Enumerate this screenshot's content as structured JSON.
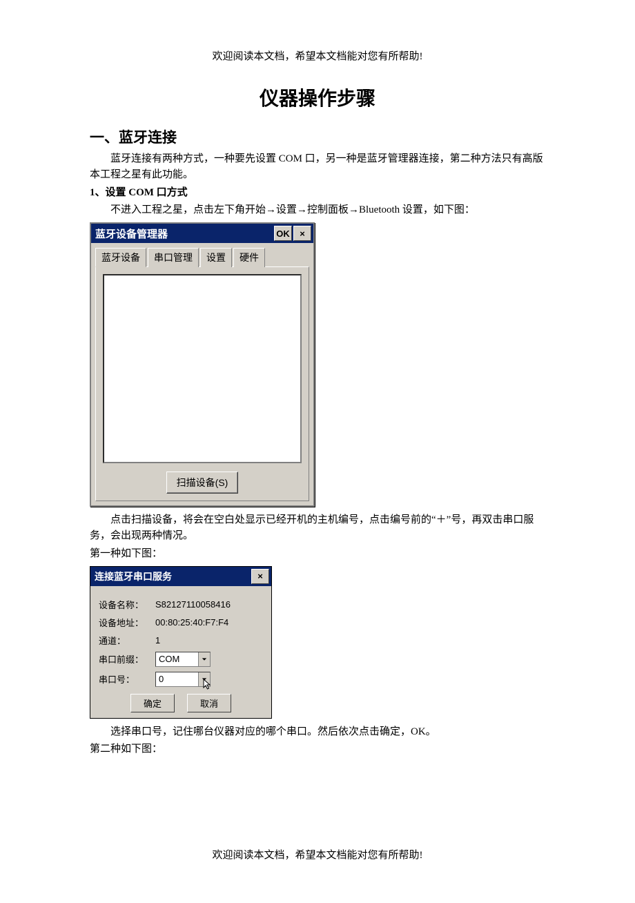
{
  "greeting": "欢迎阅读本文档，希望本文档能对您有所帮助!",
  "title": "仪器操作步骤",
  "sec1": {
    "heading": "一、蓝牙连接",
    "p1": "蓝牙连接有两种方式，一种要先设置 COM 口，另一种是蓝牙管理器连接，第二种方法只有高版本工程之星有此功能。",
    "sub1": "1、设置 COM 口方式",
    "p2": "不进入工程之星，点击左下角开始→设置→控制面板→Bluetooth 设置，如下图：",
    "p3": "点击扫描设备，将会在空白处显示已经开机的主机编号，点击编号前的“＋”号，再双击串口服务，会出现两种情况。",
    "p4": "第一种如下图：",
    "p5": "选择串口号，记住哪台仪器对应的哪个串口。然后依次点击确定，OK。",
    "p6": "第二种如下图："
  },
  "dlg1": {
    "title": "蓝牙设备管理器",
    "ok": "OK",
    "close": "×",
    "tabs": [
      "蓝牙设备",
      "串口管理",
      "设置",
      "硬件"
    ],
    "scan": "扫描设备(S)"
  },
  "dlg2": {
    "title": "连接蓝牙串口服务",
    "close": "×",
    "fields": {
      "name_lbl": "设备名称：",
      "name_val": "S82127110058416",
      "addr_lbl": "设备地址：",
      "addr_val": "00:80:25:40:F7:F4",
      "chan_lbl": "通道：",
      "chan_val": "1",
      "prefix_lbl": "串口前缀：",
      "prefix_val": "COM",
      "num_lbl": "串口号：",
      "num_val": "0"
    },
    "ok": "确定",
    "cancel": "取消"
  }
}
